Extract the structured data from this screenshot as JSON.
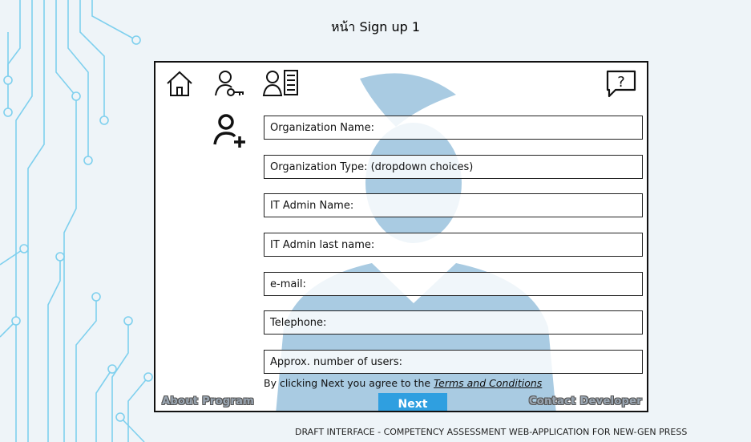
{
  "page_title": "หน้า Sign up 1",
  "form": {
    "fields": [
      {
        "label": "Organization Name:"
      },
      {
        "label": "Organization Type:  (dropdown choices)"
      },
      {
        "label": "IT Admin Name:"
      },
      {
        "label": "IT Admin last name:"
      },
      {
        "label": "e-mail:"
      },
      {
        "label": "Telephone:"
      },
      {
        "label": "Approx. number of users:"
      }
    ],
    "terms_text": "By clicking Next you agree to the ",
    "terms_link": "Terms and Conditions",
    "next_label": "Next"
  },
  "footer": {
    "about": "About Program",
    "contact": "Contact Developer",
    "caption": "DRAFT INTERFACE - COMPETENCY ASSESSMENT WEB-APPLICATION FOR NEW-GEN PRESS"
  },
  "icons": [
    "home-icon",
    "user-key-icon",
    "user-profile-icon",
    "help-icon",
    "add-user-icon"
  ],
  "colors": {
    "accent": "#2f9fe0",
    "circuit": "#7fd0ee",
    "silhouette": "#a9cbe2"
  }
}
